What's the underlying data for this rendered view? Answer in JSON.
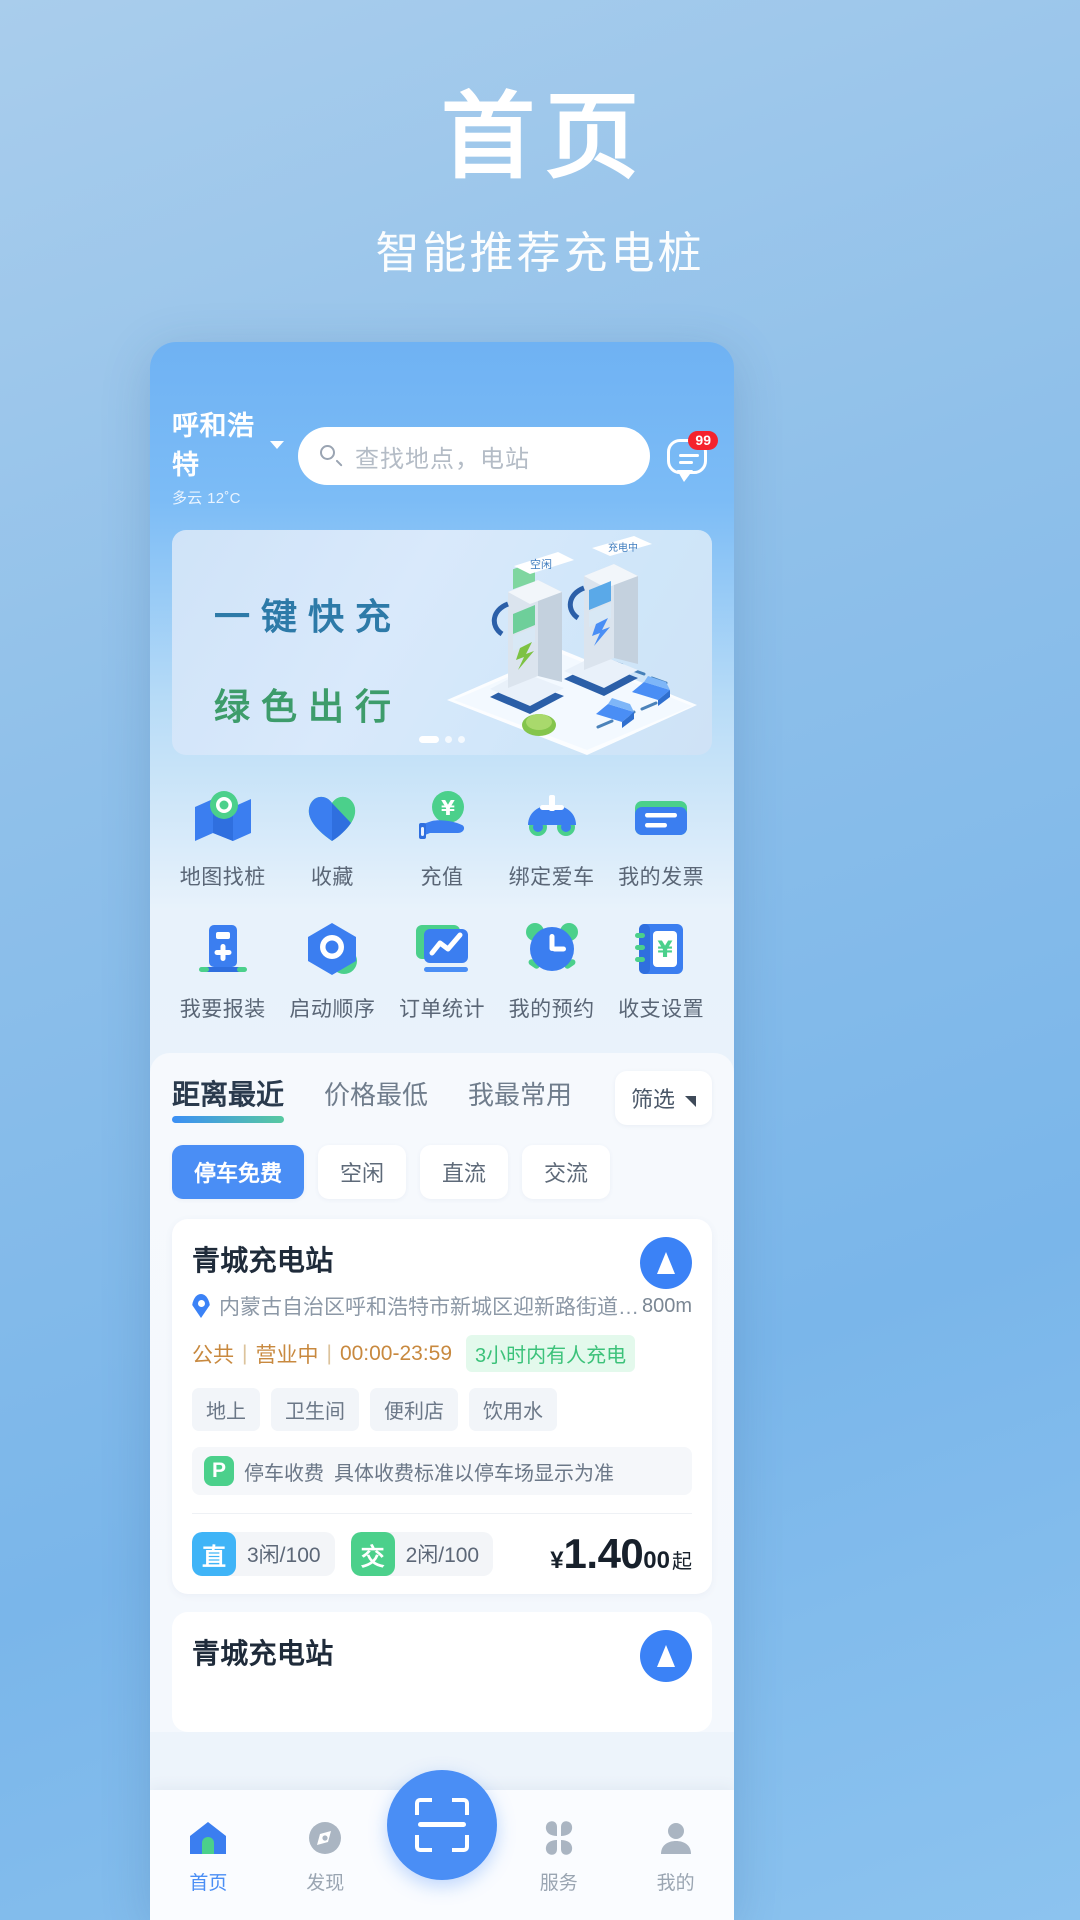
{
  "promo": {
    "title": "首页",
    "subtitle": "智能推荐充电桩"
  },
  "header": {
    "city": "呼和浩特",
    "weather": "多云 12˚C",
    "search_placeholder": "查找地点，电站",
    "message_badge": "99"
  },
  "banner": {
    "line1": "一键快充",
    "line2": "绿色出行",
    "slide_labels": [
      "空闲",
      "充电中"
    ]
  },
  "grid": {
    "row1": [
      {
        "label": "地图找桩",
        "icon": "map-pin-icon"
      },
      {
        "label": "收藏",
        "icon": "heart-icon"
      },
      {
        "label": "充值",
        "icon": "recharge-hand-yuan-icon"
      },
      {
        "label": "绑定爱车",
        "icon": "car-icon"
      },
      {
        "label": "我的发票",
        "icon": "invoice-envelope-icon"
      }
    ],
    "row2": [
      {
        "label": "我要报装",
        "icon": "charger-plus-icon"
      },
      {
        "label": "启动顺序",
        "icon": "hexagon-circle-icon"
      },
      {
        "label": "订单统计",
        "icon": "chart-monitor-icon"
      },
      {
        "label": "我的预约",
        "icon": "alarm-clock-icon"
      },
      {
        "label": "收支设置",
        "icon": "book-yuan-icon"
      }
    ]
  },
  "list": {
    "tabs": [
      {
        "label": "距离最近",
        "active": true
      },
      {
        "label": "价格最低",
        "active": false
      },
      {
        "label": "我最常用",
        "active": false
      }
    ],
    "filter_label": "筛选",
    "chips": [
      {
        "label": "停车免费",
        "active": true
      },
      {
        "label": "空闲",
        "active": false
      },
      {
        "label": "直流",
        "active": false
      },
      {
        "label": "交流",
        "active": false
      }
    ]
  },
  "station": {
    "name": "青城充电站",
    "address": "内蒙古自治区呼和浩特市新城区迎新路街道首府…",
    "distance": "800m",
    "type": "公共",
    "status": "营业中",
    "hours": "00:00-23:59",
    "activity_badge": "3小时内有人充电",
    "tags": [
      "地上",
      "卫生间",
      "便利店",
      "饮用水"
    ],
    "parking_badge": "P",
    "parking_title": "停车收费",
    "parking_note": "具体收费标准以停车场显示为准",
    "plugs": [
      {
        "badge": "直",
        "text": "3闲/100",
        "kind": "dc"
      },
      {
        "badge": "交",
        "text": "2闲/100",
        "kind": "ac"
      }
    ],
    "price_currency": "¥",
    "price_main": "1.40",
    "price_decimals": "00",
    "price_suffix": "起"
  },
  "station2": {
    "name": "青城充电站"
  },
  "tabbar": {
    "items": [
      {
        "label": "首页",
        "icon": "home-icon",
        "active": true
      },
      {
        "label": "发现",
        "icon": "compass-icon",
        "active": false
      },
      {
        "label": "服务",
        "icon": "grid-four-icon",
        "active": false
      },
      {
        "label": "我的",
        "icon": "person-icon",
        "active": false
      }
    ],
    "scan_icon": "scan-icon"
  },
  "colors": {
    "brand_blue": "#4a8ef5",
    "accent_green": "#4bd08b",
    "badge_red": "#f5222d",
    "meta_orange": "#c8893f"
  }
}
